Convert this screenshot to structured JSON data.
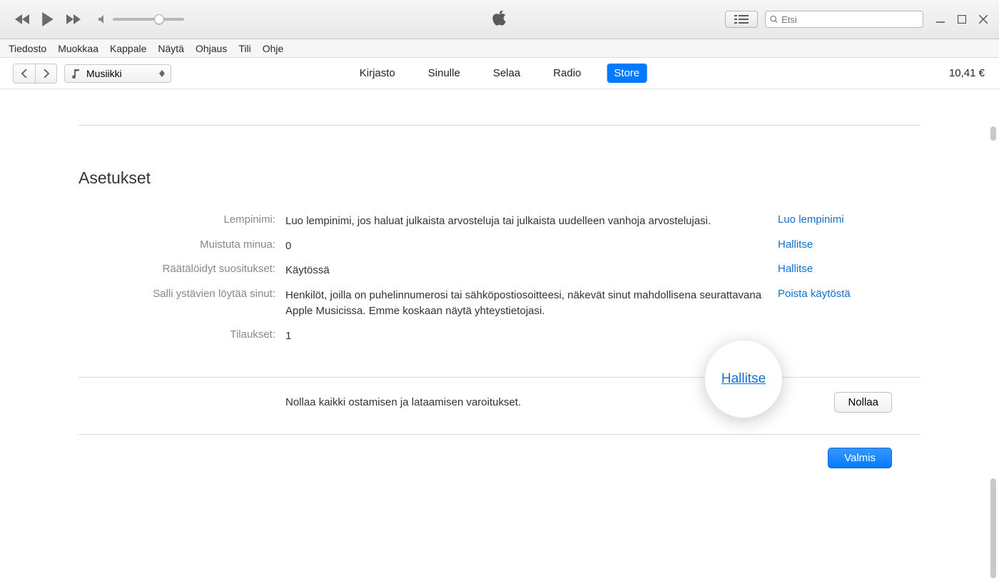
{
  "search": {
    "placeholder": "Etsi"
  },
  "menubar": [
    "Tiedosto",
    "Muokkaa",
    "Kappale",
    "Näytä",
    "Ohjaus",
    "Tili",
    "Ohje"
  ],
  "category": "Musiikki",
  "tabs": [
    {
      "label": "Kirjasto",
      "active": false
    },
    {
      "label": "Sinulle",
      "active": false
    },
    {
      "label": "Selaa",
      "active": false
    },
    {
      "label": "Radio",
      "active": false
    },
    {
      "label": "Store",
      "active": true
    }
  ],
  "balance": "10,41 €",
  "section_title": "Asetukset",
  "settings": {
    "nickname": {
      "label": "Lempinimi:",
      "value": "Luo lempinimi, jos haluat julkaista arvosteluja tai julkaista uudelleen vanhoja arvostelujasi.",
      "action": "Luo lempinimi"
    },
    "remind": {
      "label": "Muistuta minua:",
      "value": "0",
      "action": "Hallitse"
    },
    "personalized": {
      "label": "Räätälöidyt suositukset:",
      "value": "Käytössä",
      "action": "Hallitse"
    },
    "allow_friends": {
      "label": "Salli ystävien löytää sinut:",
      "value": "Henkilöt, joilla on puhelinnumerosi tai sähköpostiosoitteesi, näkevät sinut mahdollisena seurattavana Apple Musicissa. Emme koskaan näytä yhteystietojasi.",
      "action": "Poista käytöstä"
    },
    "subscriptions": {
      "label": "Tilaukset:",
      "value": "1",
      "action": "Hallitse"
    }
  },
  "reset": {
    "text": "Nollaa kaikki ostamisen ja lataamisen varoitukset.",
    "button": "Nollaa"
  },
  "done_button": "Valmis"
}
